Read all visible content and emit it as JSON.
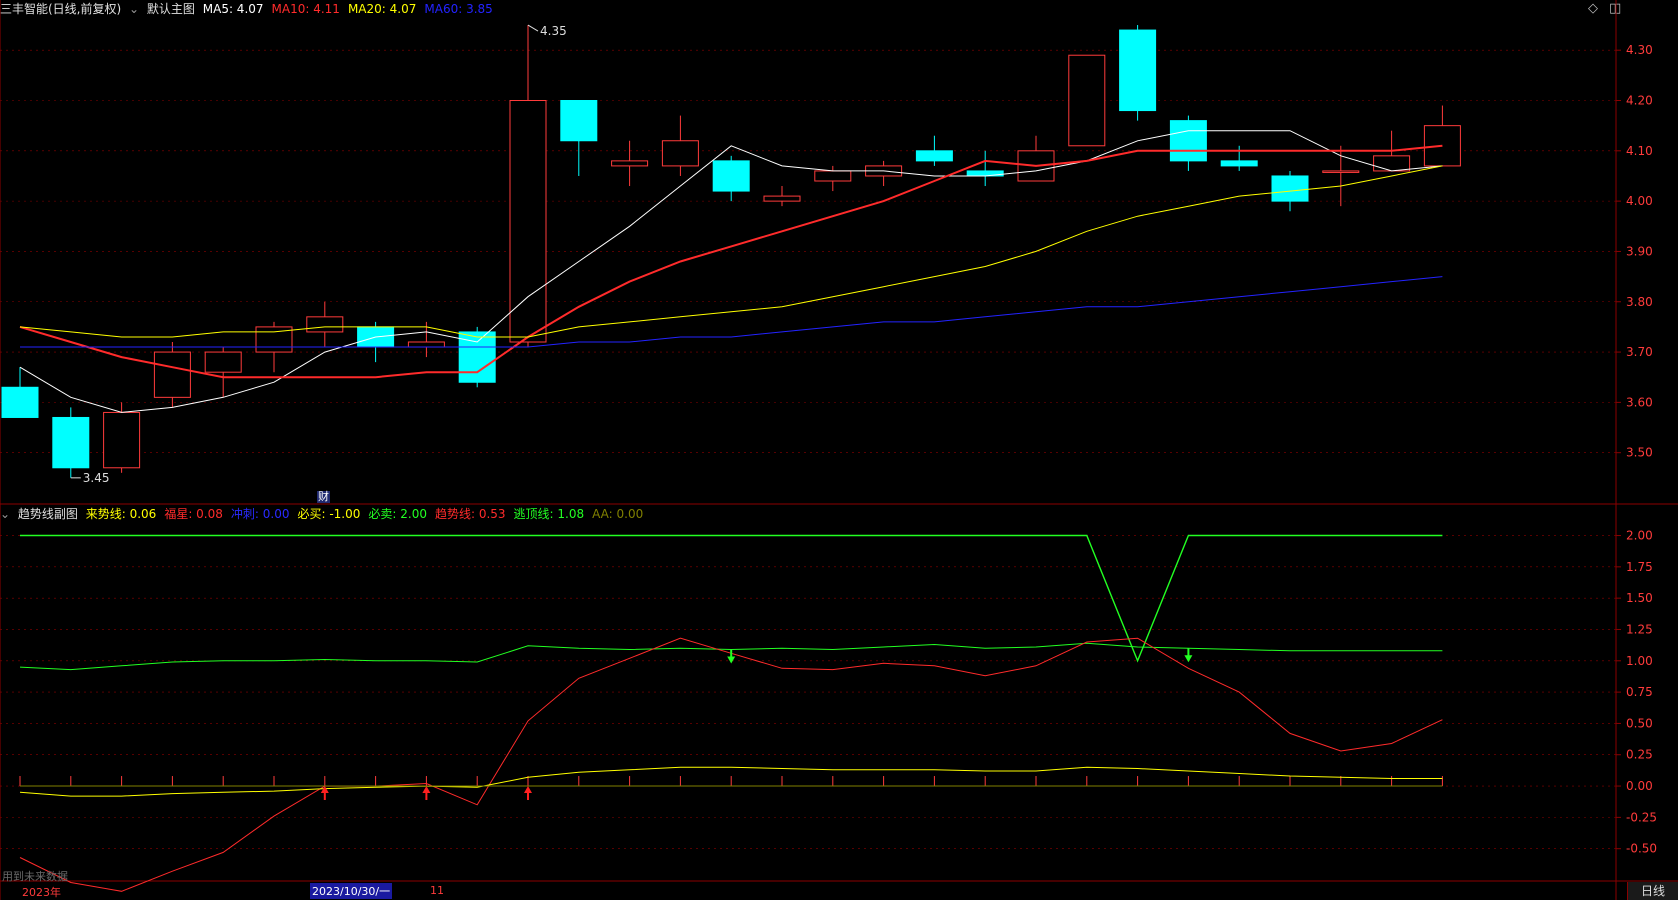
{
  "header": {
    "title": "三丰智能(日线,前复权)",
    "main_label": "默认主图",
    "indicators": [
      {
        "label": "MA5: 4.07",
        "color": "#ffffff"
      },
      {
        "label": "MA10: 4.11",
        "color": "#ff2b2b"
      },
      {
        "label": "MA20: 4.07",
        "color": "#ffff00"
      },
      {
        "label": "MA60: 3.85",
        "color": "#2323ff"
      }
    ]
  },
  "subchart_header": {
    "title": "趋势线副图",
    "indicators": [
      {
        "label": "来势线: 0.06",
        "color": "#ffff00"
      },
      {
        "label": "福星: 0.08",
        "color": "#ff2b2b"
      },
      {
        "label": "冲刺: 0.00",
        "color": "#2a2aff"
      },
      {
        "label": "必买: -1.00",
        "color": "#ffff00"
      },
      {
        "label": "必卖: 2.00",
        "color": "#22ff22"
      },
      {
        "label": "趋势线: 0.53",
        "color": "#ff2b2b"
      },
      {
        "label": "逃顶线: 1.08",
        "color": "#22ff22"
      },
      {
        "label": "AA: 0.00",
        "color": "#808000"
      }
    ]
  },
  "footer": {
    "year_label": "2023年",
    "date_cursor": "2023/10/30/一",
    "month_label": "11",
    "future_note": "用到未来数据",
    "period_tab": "日线",
    "event_marker": "财"
  },
  "colors": {
    "up": "#ff3b3b",
    "down": "#00ffff",
    "grid": "#8b0000",
    "axis_text": "#ff3b3b"
  },
  "chart_data": [
    {
      "type": "candlestick",
      "title": "三丰智能(日线,前复权)",
      "ylim": [
        3.4,
        4.36
      ],
      "yticks": [
        "4.30",
        "4.20",
        "4.10",
        "4.00",
        "3.90",
        "3.80",
        "3.70",
        "3.60",
        "3.50"
      ],
      "candles": [
        {
          "o": 3.63,
          "h": 3.67,
          "l": 3.57,
          "c": 3.57
        },
        {
          "o": 3.57,
          "h": 3.59,
          "l": 3.45,
          "c": 3.47
        },
        {
          "o": 3.47,
          "h": 3.6,
          "l": 3.46,
          "c": 3.58
        },
        {
          "o": 3.61,
          "h": 3.72,
          "l": 3.59,
          "c": 3.7
        },
        {
          "o": 3.66,
          "h": 3.71,
          "l": 3.61,
          "c": 3.7
        },
        {
          "o": 3.7,
          "h": 3.76,
          "l": 3.66,
          "c": 3.75
        },
        {
          "o": 3.74,
          "h": 3.8,
          "l": 3.71,
          "c": 3.77
        },
        {
          "o": 3.75,
          "h": 3.76,
          "l": 3.68,
          "c": 3.71
        },
        {
          "o": 3.71,
          "h": 3.76,
          "l": 3.69,
          "c": 3.72
        },
        {
          "o": 3.74,
          "h": 3.75,
          "l": 3.63,
          "c": 3.64
        },
        {
          "o": 3.72,
          "h": 4.35,
          "l": 3.71,
          "c": 4.2
        },
        {
          "o": 4.2,
          "h": 4.2,
          "l": 4.05,
          "c": 4.12
        },
        {
          "o": 4.07,
          "h": 4.12,
          "l": 4.03,
          "c": 4.08
        },
        {
          "o": 4.07,
          "h": 4.17,
          "l": 4.05,
          "c": 4.12
        },
        {
          "o": 4.08,
          "h": 4.09,
          "l": 4.0,
          "c": 4.02
        },
        {
          "o": 4.0,
          "h": 4.03,
          "l": 3.99,
          "c": 4.01
        },
        {
          "o": 4.04,
          "h": 4.07,
          "l": 4.02,
          "c": 4.06
        },
        {
          "o": 4.05,
          "h": 4.08,
          "l": 4.03,
          "c": 4.07
        },
        {
          "o": 4.1,
          "h": 4.13,
          "l": 4.07,
          "c": 4.08
        },
        {
          "o": 4.06,
          "h": 4.1,
          "l": 4.03,
          "c": 4.05
        },
        {
          "o": 4.04,
          "h": 4.13,
          "l": 4.04,
          "c": 4.1
        },
        {
          "o": 4.11,
          "h": 4.29,
          "l": 4.11,
          "c": 4.29
        },
        {
          "o": 4.34,
          "h": 4.35,
          "l": 4.16,
          "c": 4.18
        },
        {
          "o": 4.16,
          "h": 4.17,
          "l": 4.06,
          "c": 4.08
        },
        {
          "o": 4.08,
          "h": 4.11,
          "l": 4.06,
          "c": 4.07
        },
        {
          "o": 4.05,
          "h": 4.06,
          "l": 3.98,
          "c": 4.0
        },
        {
          "o": 4.06,
          "h": 4.11,
          "l": 3.99,
          "c": 4.06
        },
        {
          "o": 4.06,
          "h": 4.14,
          "l": 4.06,
          "c": 4.09
        },
        {
          "o": 4.07,
          "h": 4.19,
          "l": 4.07,
          "c": 4.15
        }
      ],
      "series": [
        {
          "name": "MA5",
          "color": "#ffffff",
          "width": 1,
          "values": [
            3.67,
            3.61,
            3.58,
            3.59,
            3.61,
            3.64,
            3.7,
            3.73,
            3.74,
            3.72,
            3.81,
            3.88,
            3.95,
            4.03,
            4.11,
            4.07,
            4.06,
            4.06,
            4.05,
            4.05,
            4.06,
            4.08,
            4.12,
            4.14,
            4.14,
            4.14,
            4.09,
            4.06,
            4.07
          ]
        },
        {
          "name": "MA10",
          "color": "#ff2b2b",
          "width": 2,
          "values": [
            3.75,
            3.72,
            3.69,
            3.67,
            3.65,
            3.65,
            3.65,
            3.65,
            3.66,
            3.66,
            3.73,
            3.79,
            3.84,
            3.88,
            3.91,
            3.94,
            3.97,
            4.0,
            4.04,
            4.08,
            4.07,
            4.08,
            4.1,
            4.1,
            4.1,
            4.1,
            4.1,
            4.1,
            4.11
          ]
        },
        {
          "name": "MA20",
          "color": "#ffff00",
          "width": 1,
          "values": [
            3.75,
            3.74,
            3.73,
            3.73,
            3.74,
            3.74,
            3.75,
            3.75,
            3.75,
            3.73,
            3.73,
            3.75,
            3.76,
            3.77,
            3.78,
            3.79,
            3.81,
            3.83,
            3.85,
            3.87,
            3.9,
            3.94,
            3.97,
            3.99,
            4.01,
            4.02,
            4.03,
            4.05,
            4.07
          ]
        },
        {
          "name": "MA60",
          "color": "#2323ff",
          "width": 1,
          "values": [
            3.71,
            3.71,
            3.71,
            3.71,
            3.71,
            3.71,
            3.71,
            3.71,
            3.71,
            3.71,
            3.71,
            3.72,
            3.72,
            3.73,
            3.73,
            3.74,
            3.75,
            3.76,
            3.76,
            3.77,
            3.78,
            3.79,
            3.79,
            3.8,
            3.81,
            3.82,
            3.83,
            3.84,
            3.85
          ]
        }
      ],
      "annotations": [
        {
          "label": "4.35",
          "index": 10,
          "value": 4.35,
          "side": "right"
        },
        {
          "label": "3.45",
          "index": 1,
          "value": 3.45,
          "side": "right"
        }
      ]
    },
    {
      "type": "line",
      "title": "趋势线副图",
      "ylim": [
        -0.75,
        2.1
      ],
      "yticks": [
        "2.00",
        "1.75",
        "1.50",
        "1.25",
        "1.00",
        "0.75",
        "0.50",
        "0.25",
        "0.00",
        "-0.25",
        "-0.50"
      ],
      "series": [
        {
          "name": "必卖",
          "color": "#22ff22",
          "width": 1.4,
          "values": [
            2,
            2,
            2,
            2,
            2,
            2,
            2,
            2,
            2,
            2,
            2,
            2,
            2,
            2,
            2,
            2,
            2,
            2,
            2,
            2,
            2,
            2,
            1.0,
            2,
            2,
            2,
            2,
            2,
            2
          ]
        },
        {
          "name": "逃顶线",
          "color": "#22ff22",
          "width": 1,
          "values": [
            0.95,
            0.93,
            0.96,
            0.99,
            1.0,
            1.0,
            1.01,
            1.0,
            1.0,
            0.99,
            1.12,
            1.1,
            1.09,
            1.1,
            1.09,
            1.1,
            1.09,
            1.11,
            1.13,
            1.1,
            1.11,
            1.14,
            1.11,
            1.1,
            1.09,
            1.08,
            1.08,
            1.08,
            1.08
          ]
        },
        {
          "name": "趋势线",
          "color": "#ff2b2b",
          "width": 1,
          "values": [
            -0.57,
            -0.77,
            -0.84,
            -0.68,
            -0.53,
            -0.24,
            0.0,
            0.0,
            0.02,
            -0.15,
            0.52,
            0.86,
            1.02,
            1.18,
            1.06,
            0.94,
            0.93,
            0.98,
            0.96,
            0.88,
            0.96,
            1.15,
            1.18,
            0.94,
            0.75,
            0.42,
            0.28,
            0.34,
            0.53
          ]
        },
        {
          "name": "来势线",
          "color": "#ffff00",
          "width": 1,
          "values": [
            -0.05,
            -0.08,
            -0.08,
            -0.06,
            -0.05,
            -0.04,
            -0.02,
            -0.01,
            0.0,
            -0.01,
            0.07,
            0.11,
            0.13,
            0.15,
            0.15,
            0.14,
            0.13,
            0.13,
            0.13,
            0.12,
            0.12,
            0.15,
            0.14,
            0.12,
            0.1,
            0.08,
            0.07,
            0.06,
            0.06
          ]
        },
        {
          "name": "必买",
          "color": "#ffff00",
          "width": 1.6,
          "values": [
            -1,
            -1,
            -1,
            -1,
            -1,
            -1,
            -1,
            -1,
            -1,
            -1,
            -1,
            -1,
            -1,
            -1,
            -1,
            -1,
            -1,
            -1,
            -1,
            -1,
            -1,
            -1,
            -1,
            -1,
            -1,
            -1,
            -1,
            -1,
            -1
          ]
        }
      ],
      "markers": [
        {
          "index": 6,
          "type": "buy"
        },
        {
          "index": 8,
          "type": "buy"
        },
        {
          "index": 10,
          "type": "buy"
        },
        {
          "index": 14,
          "type": "sell"
        },
        {
          "index": 23,
          "type": "sell"
        }
      ]
    }
  ]
}
